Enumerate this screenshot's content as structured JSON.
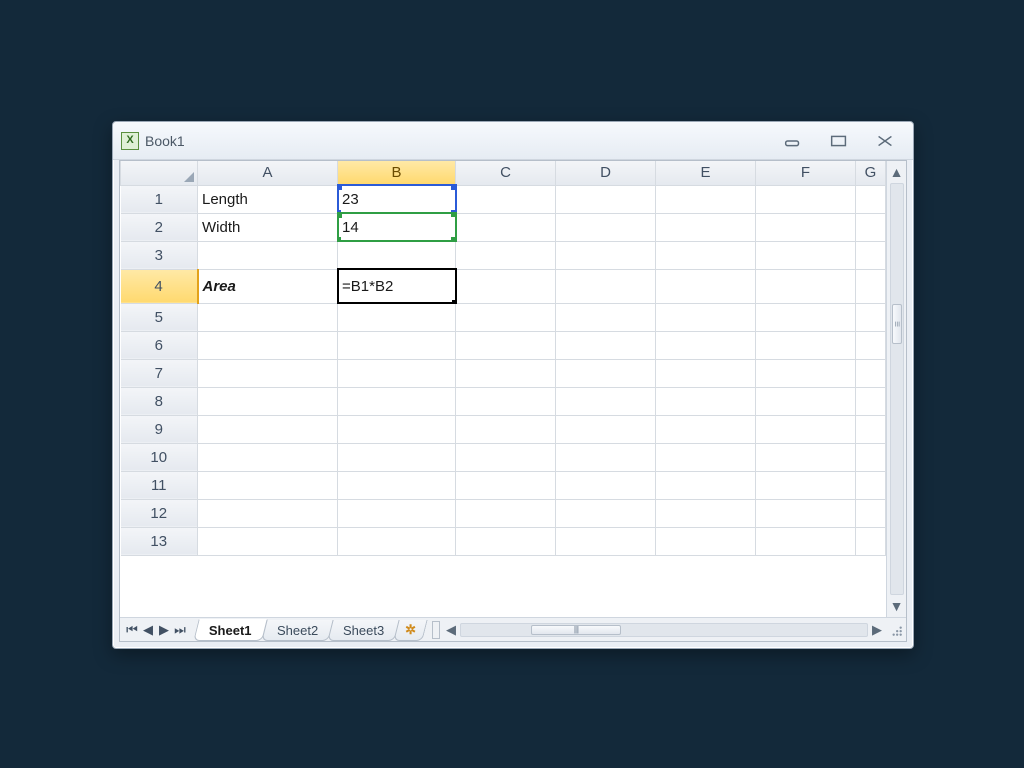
{
  "window": {
    "title": "Book1"
  },
  "columns": [
    "A",
    "B",
    "C",
    "D",
    "E",
    "F",
    "G"
  ],
  "row_headers": [
    1,
    2,
    3,
    4,
    5,
    6,
    7,
    8,
    9,
    10,
    11,
    12,
    13
  ],
  "cells": {
    "A1": "Length",
    "B1": "23",
    "A2": "Width",
    "B2": "14",
    "A4": "Area",
    "B4": "=B1*B2"
  },
  "selection": {
    "active_cell": "B4",
    "highlighted_column": "B",
    "highlighted_row": 4,
    "formula_refs": [
      {
        "cell": "B1",
        "color": "blue"
      },
      {
        "cell": "B2",
        "color": "green"
      }
    ]
  },
  "sheet_tabs": {
    "active": "Sheet1",
    "tabs": [
      "Sheet1",
      "Sheet2",
      "Sheet3"
    ]
  }
}
